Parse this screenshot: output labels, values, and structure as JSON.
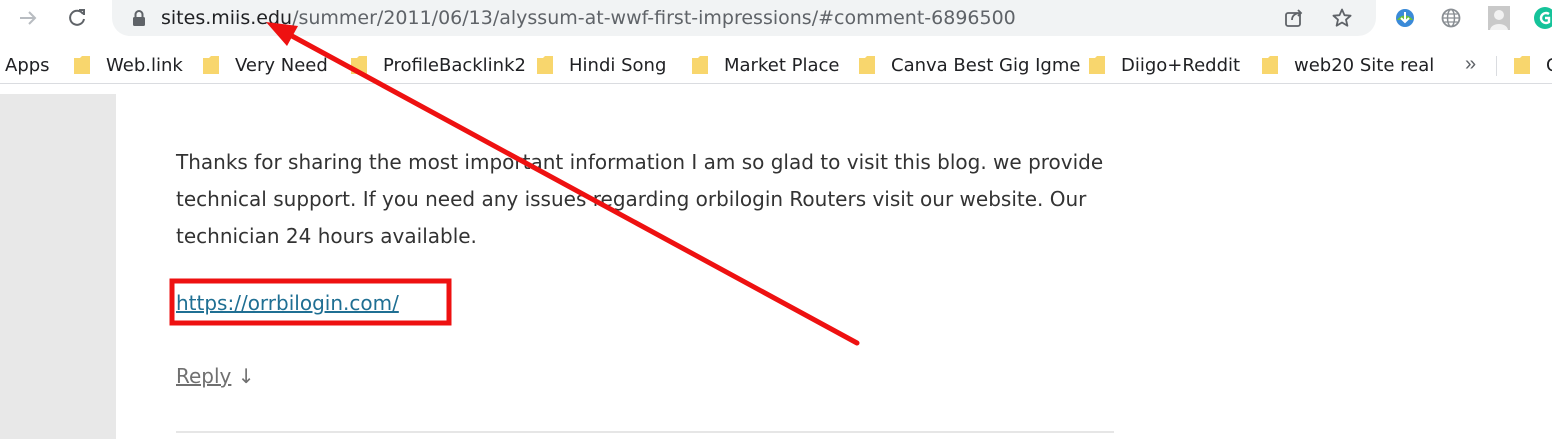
{
  "browser": {
    "url_host": "sites.miis.edu",
    "url_path": "/summer/2011/06/13/alyssum-at-wwf-first-impressions/#comment-6896500"
  },
  "bookmarks": {
    "apps_label": "Apps",
    "items": [
      {
        "label": "Web.link"
      },
      {
        "label": "Very Need"
      },
      {
        "label": "ProfileBacklink2"
      },
      {
        "label": "Hindi Song"
      },
      {
        "label": "Market Place"
      },
      {
        "label": "Canva Best Gig Igme"
      },
      {
        "label": "Diigo+Reddit"
      },
      {
        "label": "web20 Site real"
      },
      {
        "label": "C"
      }
    ],
    "more_label": "»"
  },
  "comment": {
    "body": "Thanks for sharing the most important information I am so glad to visit this blog. we provide technical support. If you need any issues regarding orbilogin Routers visit our website. Our technician 24 hours available.",
    "link": "https://orrbilogin.com/",
    "reply_label": "Reply",
    "reply_arrow": "↓"
  },
  "colors": {
    "annotation": "#ee1111",
    "link": "#1f6f93",
    "folder": "#f8d66d"
  }
}
